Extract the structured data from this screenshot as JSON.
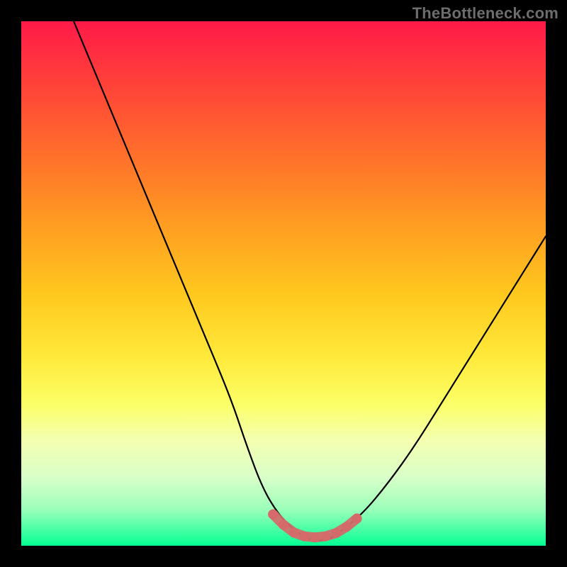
{
  "watermark": "TheBottleneck.com",
  "colors": {
    "page_bg": "#000000",
    "curve_stroke": "#000000",
    "marker_fill": "#d46a6a",
    "marker_stroke": "#d46a6a"
  },
  "chart_data": {
    "type": "line",
    "title": "",
    "xlabel": "",
    "ylabel": "",
    "xlim": [
      0,
      100
    ],
    "ylim": [
      0,
      100
    ],
    "grid": false,
    "series": [
      {
        "name": "bottleneck-curve",
        "x": [
          10,
          15,
          20,
          25,
          30,
          35,
          40,
          43,
          46,
          49,
          52,
          55,
          58,
          60,
          65,
          70,
          75,
          80,
          85,
          90,
          95,
          100
        ],
        "y": [
          100,
          88,
          76,
          64,
          52,
          40,
          28,
          19,
          11,
          6,
          3,
          1,
          1,
          2,
          6,
          12,
          19,
          27,
          35,
          43,
          51,
          59
        ]
      }
    ],
    "markers": {
      "name": "valley-highlight",
      "color": "#d46a6a",
      "points": [
        {
          "x": 48,
          "y": 6
        },
        {
          "x": 50,
          "y": 4
        },
        {
          "x": 52,
          "y": 2.5
        },
        {
          "x": 54,
          "y": 1.8
        },
        {
          "x": 56,
          "y": 1.6
        },
        {
          "x": 58,
          "y": 1.8
        },
        {
          "x": 60,
          "y": 2.4
        },
        {
          "x": 62,
          "y": 3.6
        },
        {
          "x": 64,
          "y": 5.2
        }
      ]
    }
  }
}
